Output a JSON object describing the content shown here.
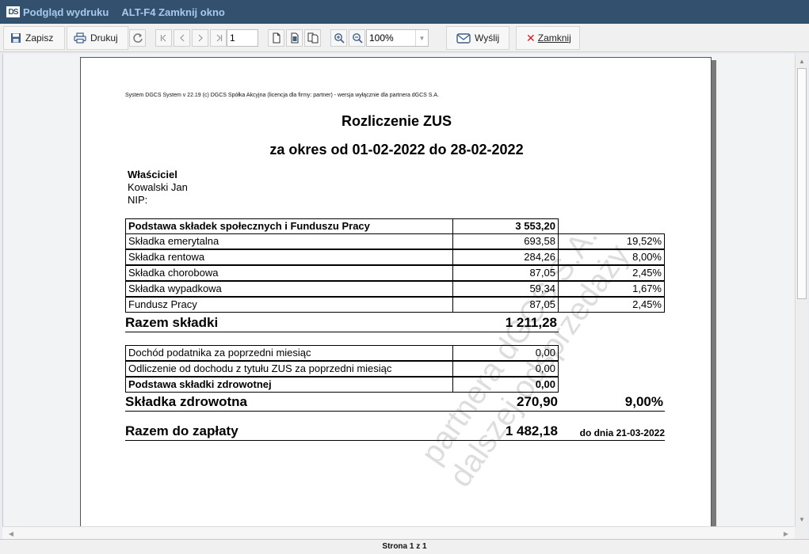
{
  "window": {
    "logo": "DS",
    "title": "Podgląd wydruku",
    "hint": "ALT-F4 Zamknij okno"
  },
  "toolbar": {
    "save_label": "Zapisz",
    "print_label": "Drukuj",
    "page_value": "1",
    "zoom_value": "100%",
    "send_label": "Wyślij",
    "close_label": "Zamknij"
  },
  "document": {
    "system_line": "System DGCS System v 22.19  (c) DGCS Spółka Akcyjna (licencja dla firmy: partner) - wersja wyłącznie dla partnera dGCS S.A.",
    "title": "Rozliczenie ZUS",
    "period": "za okres od 01-02-2022 do 28-02-2022",
    "owner": {
      "heading": "Właściciel",
      "name": "Kowalski Jan",
      "nip": "NIP:"
    },
    "social": {
      "base_label": "Podstawa składek społecznych i Funduszu Pracy",
      "base_value": "3 553,20",
      "rows": [
        {
          "label": "Składka emerytalna",
          "value": "693,58",
          "percent": "19,52%"
        },
        {
          "label": "Składka rentowa",
          "value": "284,26",
          "percent": "8,00%"
        },
        {
          "label": "Składka chorobowa",
          "value": "87,05",
          "percent": "2,45%"
        },
        {
          "label": "Składka wypadkowa",
          "value": "59,34",
          "percent": "1,67%"
        },
        {
          "label": "Fundusz Pracy",
          "value": "87,05",
          "percent": "2,45%"
        }
      ],
      "total_label": "Razem składki",
      "total_value": "1 211,28"
    },
    "health": {
      "rows": [
        {
          "label": "Dochód podatnika za poprzedni miesiąc",
          "value": "0,00"
        },
        {
          "label": "Odliczenie od dochodu z tytułu ZUS za poprzedni miesiąc",
          "value": "0,00"
        },
        {
          "label": "Podstawa składki zdrowotnej",
          "value": "0,00"
        }
      ],
      "total_label": "Składka zdrowotna",
      "total_value": "270,90",
      "total_percent": "9,00%"
    },
    "payment": {
      "label": "Razem do zapłaty",
      "value": "1 482,18",
      "due": "do dnia 21-03-2022"
    },
    "watermark_line1": "partnera dGCS S.A.",
    "watermark_line2": "dalszej odsprzedaży"
  },
  "status": {
    "page_info": "Strona 1 z 1"
  }
}
